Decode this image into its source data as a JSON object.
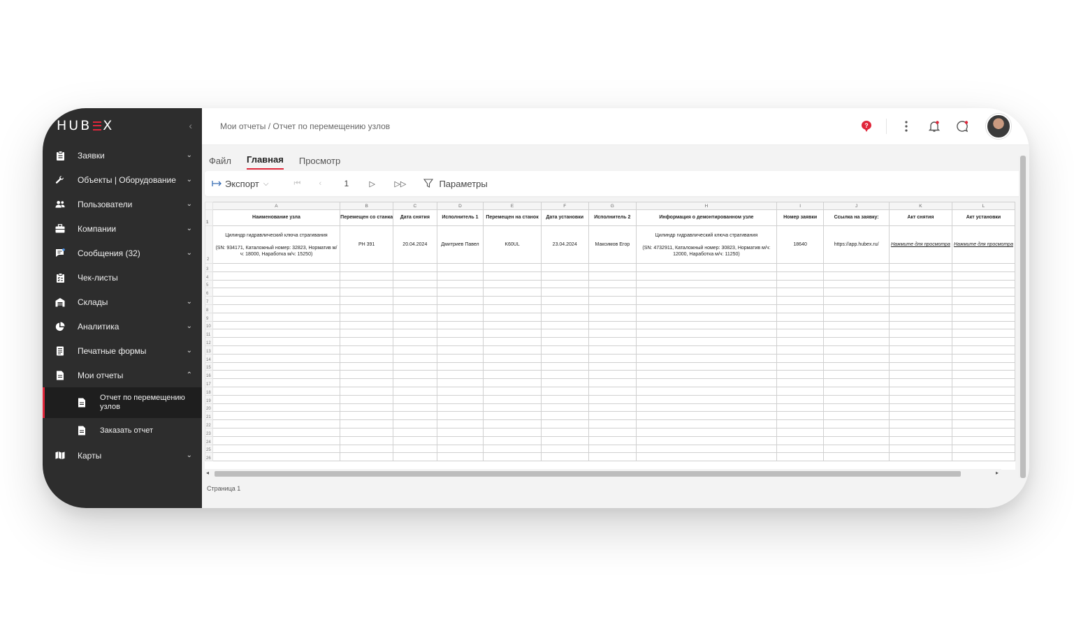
{
  "brand": {
    "logo_left": "HUB",
    "logo_right": "X",
    "accent": "#e0263a"
  },
  "sidebar": {
    "collapse_icon": "chevron-left-icon",
    "items": [
      {
        "label": "Заявки",
        "icon": "clipboard-icon",
        "expandable": true
      },
      {
        "label": "Объекты | Оборудование",
        "icon": "wrench-icon",
        "expandable": true
      },
      {
        "label": "Пользователи",
        "icon": "users-icon",
        "expandable": true
      },
      {
        "label": "Компании",
        "icon": "briefcase-icon",
        "expandable": true
      },
      {
        "label": "Сообщения (32)",
        "icon": "message-icon",
        "expandable": true
      },
      {
        "label": "Чек-листы",
        "icon": "checklist-icon",
        "expandable": false
      },
      {
        "label": "Склады",
        "icon": "warehouse-icon",
        "expandable": true
      },
      {
        "label": "Аналитика",
        "icon": "pie-chart-icon",
        "expandable": true
      },
      {
        "label": "Печатные формы",
        "icon": "print-form-icon",
        "expandable": true
      },
      {
        "label": "Мои отчеты",
        "icon": "report-icon",
        "expandable": true,
        "open": true
      },
      {
        "label": "Карты",
        "icon": "map-icon",
        "expandable": true
      }
    ],
    "subitems": [
      {
        "label": "Отчет по перемещению узлов",
        "icon": "document-icon",
        "active": true
      },
      {
        "label": "Заказать отчет",
        "icon": "document-icon",
        "active": false
      }
    ]
  },
  "header": {
    "breadcrumb": "Мои отчеты / Отчет по перемещению узлов",
    "icons": [
      "help-icon",
      "more-vertical-icon",
      "bell-icon",
      "chat-icon",
      "avatar"
    ]
  },
  "tabs": [
    {
      "label": "Файл",
      "active": false
    },
    {
      "label": "Главная",
      "active": true
    },
    {
      "label": "Просмотр",
      "active": false
    }
  ],
  "toolbar": {
    "export_label": "Экспорт",
    "page_number": "1",
    "params_label": "Параметры"
  },
  "sheet": {
    "column_letters": [
      "A",
      "B",
      "C",
      "D",
      "E",
      "F",
      "G",
      "H",
      "I",
      "J",
      "K",
      "L"
    ],
    "headers": [
      "Наименование узла",
      "Перемещен со станка",
      "Дата снятия",
      "Исполнитель 1",
      "Перемещен на станок",
      "Дата установки",
      "Исполнитель 2",
      "Информация о демонтированном узле",
      "Номер заявки",
      "Ссылка на заявку:",
      "Акт снятия",
      "Акт установки"
    ],
    "row": [
      "Цилиндр гидравлический ключа страгивания\n\n(SN: 934171, Каталожный номер: 32823, Норматив м/ч: 18000, Наработка м/ч: 15250)",
      "PH 391",
      "20.04.2024",
      "Дмитриев Павел",
      "K60UL",
      "23.04.2024",
      "Максимов Егор",
      "Цилиндр гидравлический ключа страгивания\n\n(SN: 4732911, Каталожный номер: 30823, Норматив м/ч: 12000, Наработка м/ч: 11250)",
      "18640",
      "https://app.hubex.ru/",
      "Нажмите для просмотра",
      "Нажмите для просмотра"
    ],
    "empty_rows": 24
  },
  "status": {
    "page_label": "Страница 1"
  }
}
